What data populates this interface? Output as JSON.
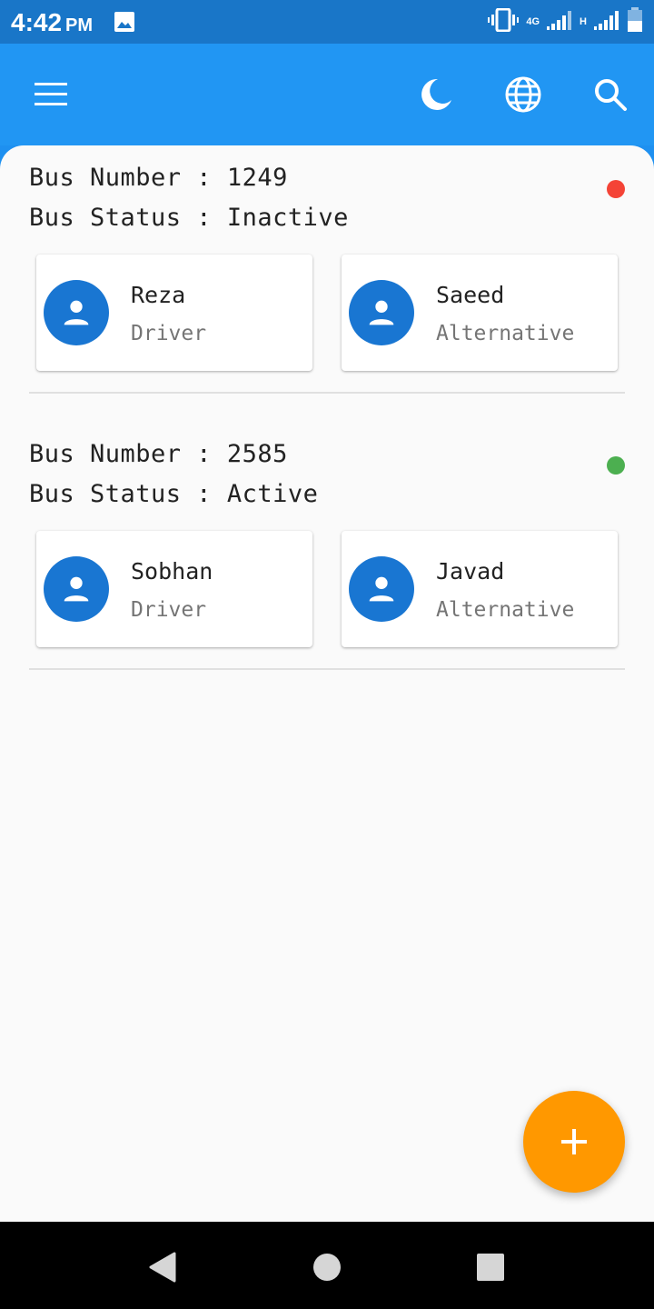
{
  "status_bar": {
    "time": "4:42",
    "ampm": "PM",
    "network_1": "4G",
    "network_2": "H",
    "icons": [
      "image-icon",
      "vibrate-icon",
      "signal-icon",
      "signal-icon",
      "battery-icon"
    ]
  },
  "app_bar": {
    "icons": [
      "menu-icon",
      "dark-mode-icon",
      "language-icon",
      "search-icon"
    ]
  },
  "buses": [
    {
      "number_label": "Bus Number : 1249",
      "status_label": "Bus Status : Inactive",
      "status_color": "#f44336",
      "driver": {
        "name": "Reza",
        "role": "Driver"
      },
      "alternative": {
        "name": "Saeed",
        "role": "Alternative"
      }
    },
    {
      "number_label": "Bus Number : 2585",
      "status_label": "Bus Status : Active",
      "status_color": "#4caf50",
      "driver": {
        "name": "Sobhan",
        "role": "Driver"
      },
      "alternative": {
        "name": "Javad",
        "role": "Alternative"
      }
    }
  ],
  "fab": {
    "icon": "add-icon",
    "color": "#ff9800"
  },
  "colors": {
    "primary": "#2196f3",
    "status_bar": "#1976c8",
    "avatar": "#1976d2"
  }
}
